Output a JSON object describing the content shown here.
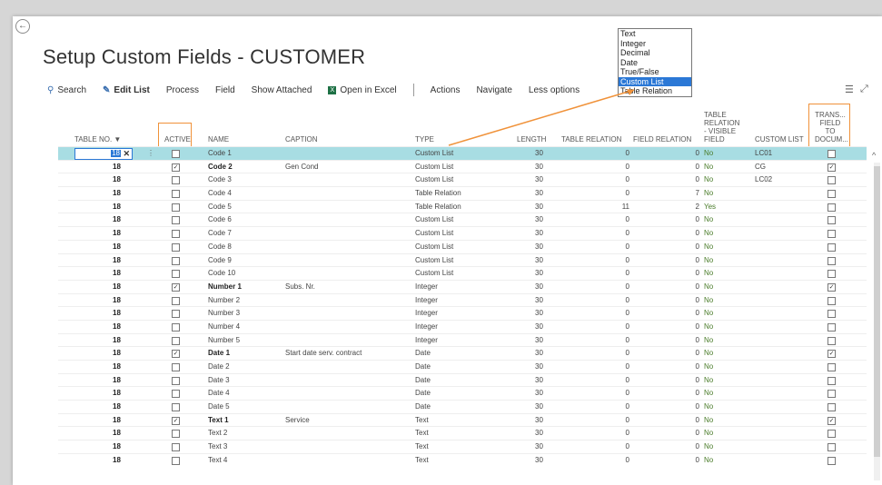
{
  "page": {
    "title": "Setup Custom Fields  - CUSTOMER"
  },
  "actions": {
    "search": "Search",
    "edit_list": "Edit List",
    "process": "Process",
    "field": "Field",
    "show_attached": "Show Attached",
    "open_excel": "Open in Excel",
    "actions": "Actions",
    "navigate": "Navigate",
    "less_options": "Less options"
  },
  "icons": {
    "back": "back-arrow-icon",
    "search": "search-icon",
    "edit_list": "edit-list-icon",
    "excel": "excel-icon",
    "filter": "filter-icon",
    "collapse": "collapse-icon"
  },
  "type_dropdown": {
    "options": [
      "Text",
      "Integer",
      "Decimal",
      "Date",
      "True/False",
      "Custom List",
      "Table Relation"
    ],
    "selected": "Custom List"
  },
  "columns": {
    "table_no": "TABLE NO. ▼",
    "active": "ACTIVE",
    "name": "NAME",
    "caption": "CAPTION",
    "type": "TYPE",
    "length": "LENGTH",
    "table_relation": "TABLE RELATION",
    "field_relation": "FIELD RELATION",
    "table_relation_visible_1": "TABLE",
    "table_relation_visible_2": "RELATION",
    "table_relation_visible_3": "- VISIBLE",
    "table_relation_visible_4": "FIELD",
    "custom_list": "CUSTOM LIST",
    "trans_1": "TRANS...",
    "trans_2": "FIELD",
    "trans_3": "TO",
    "trans_4": "DOCUM..."
  },
  "edit_row_value": "18",
  "rows": [
    {
      "table_no": "18",
      "active": false,
      "name": "Code 1",
      "bold": false,
      "caption": "",
      "type": "Custom List",
      "length": "30",
      "table_relation": "0",
      "field_relation": "0",
      "visible": "No",
      "custom_list": "LC01",
      "trans": false
    },
    {
      "table_no": "18",
      "active": true,
      "name": "Code 2",
      "bold": true,
      "caption": "Gen Cond",
      "type": "Custom List",
      "length": "30",
      "table_relation": "0",
      "field_relation": "0",
      "visible": "No",
      "custom_list": "CG",
      "trans": true
    },
    {
      "table_no": "18",
      "active": false,
      "name": "Code 3",
      "bold": false,
      "caption": "",
      "type": "Custom List",
      "length": "30",
      "table_relation": "0",
      "field_relation": "0",
      "visible": "No",
      "custom_list": "LC02",
      "trans": false
    },
    {
      "table_no": "18",
      "active": false,
      "name": "Code 4",
      "bold": false,
      "caption": "",
      "type": "Table Relation",
      "length": "30",
      "table_relation": "0",
      "field_relation": "7",
      "visible": "No",
      "custom_list": "",
      "trans": false
    },
    {
      "table_no": "18",
      "active": false,
      "name": "Code 5",
      "bold": false,
      "caption": "",
      "type": "Table Relation",
      "length": "30",
      "table_relation": "11",
      "field_relation": "2",
      "visible": "Yes",
      "custom_list": "",
      "trans": false
    },
    {
      "table_no": "18",
      "active": false,
      "name": "Code 6",
      "bold": false,
      "caption": "",
      "type": "Custom List",
      "length": "30",
      "table_relation": "0",
      "field_relation": "0",
      "visible": "No",
      "custom_list": "",
      "trans": false
    },
    {
      "table_no": "18",
      "active": false,
      "name": "Code 7",
      "bold": false,
      "caption": "",
      "type": "Custom List",
      "length": "30",
      "table_relation": "0",
      "field_relation": "0",
      "visible": "No",
      "custom_list": "",
      "trans": false
    },
    {
      "table_no": "18",
      "active": false,
      "name": "Code 8",
      "bold": false,
      "caption": "",
      "type": "Custom List",
      "length": "30",
      "table_relation": "0",
      "field_relation": "0",
      "visible": "No",
      "custom_list": "",
      "trans": false
    },
    {
      "table_no": "18",
      "active": false,
      "name": "Code 9",
      "bold": false,
      "caption": "",
      "type": "Custom List",
      "length": "30",
      "table_relation": "0",
      "field_relation": "0",
      "visible": "No",
      "custom_list": "",
      "trans": false
    },
    {
      "table_no": "18",
      "active": false,
      "name": "Code 10",
      "bold": false,
      "caption": "",
      "type": "Custom List",
      "length": "30",
      "table_relation": "0",
      "field_relation": "0",
      "visible": "No",
      "custom_list": "",
      "trans": false
    },
    {
      "table_no": "18",
      "active": true,
      "name": "Number 1",
      "bold": true,
      "caption": "Subs. Nr.",
      "type": "Integer",
      "length": "30",
      "table_relation": "0",
      "field_relation": "0",
      "visible": "No",
      "custom_list": "",
      "trans": true
    },
    {
      "table_no": "18",
      "active": false,
      "name": "Number 2",
      "bold": false,
      "caption": "",
      "type": "Integer",
      "length": "30",
      "table_relation": "0",
      "field_relation": "0",
      "visible": "No",
      "custom_list": "",
      "trans": false
    },
    {
      "table_no": "18",
      "active": false,
      "name": "Number 3",
      "bold": false,
      "caption": "",
      "type": "Integer",
      "length": "30",
      "table_relation": "0",
      "field_relation": "0",
      "visible": "No",
      "custom_list": "",
      "trans": false
    },
    {
      "table_no": "18",
      "active": false,
      "name": "Number 4",
      "bold": false,
      "caption": "",
      "type": "Integer",
      "length": "30",
      "table_relation": "0",
      "field_relation": "0",
      "visible": "No",
      "custom_list": "",
      "trans": false
    },
    {
      "table_no": "18",
      "active": false,
      "name": "Number 5",
      "bold": false,
      "caption": "",
      "type": "Integer",
      "length": "30",
      "table_relation": "0",
      "field_relation": "0",
      "visible": "No",
      "custom_list": "",
      "trans": false
    },
    {
      "table_no": "18",
      "active": true,
      "name": "Date 1",
      "bold": true,
      "caption": "Start date serv. contract",
      "type": "Date",
      "length": "30",
      "table_relation": "0",
      "field_relation": "0",
      "visible": "No",
      "custom_list": "",
      "trans": true
    },
    {
      "table_no": "18",
      "active": false,
      "name": "Date 2",
      "bold": false,
      "caption": "",
      "type": "Date",
      "length": "30",
      "table_relation": "0",
      "field_relation": "0",
      "visible": "No",
      "custom_list": "",
      "trans": false
    },
    {
      "table_no": "18",
      "active": false,
      "name": "Date 3",
      "bold": false,
      "caption": "",
      "type": "Date",
      "length": "30",
      "table_relation": "0",
      "field_relation": "0",
      "visible": "No",
      "custom_list": "",
      "trans": false
    },
    {
      "table_no": "18",
      "active": false,
      "name": "Date 4",
      "bold": false,
      "caption": "",
      "type": "Date",
      "length": "30",
      "table_relation": "0",
      "field_relation": "0",
      "visible": "No",
      "custom_list": "",
      "trans": false
    },
    {
      "table_no": "18",
      "active": false,
      "name": "Date 5",
      "bold": false,
      "caption": "",
      "type": "Date",
      "length": "30",
      "table_relation": "0",
      "field_relation": "0",
      "visible": "No",
      "custom_list": "",
      "trans": false
    },
    {
      "table_no": "18",
      "active": true,
      "name": "Text 1",
      "bold": true,
      "caption": "Service",
      "type": "Text",
      "length": "30",
      "table_relation": "0",
      "field_relation": "0",
      "visible": "No",
      "custom_list": "",
      "trans": true
    },
    {
      "table_no": "18",
      "active": false,
      "name": "Text 2",
      "bold": false,
      "caption": "",
      "type": "Text",
      "length": "30",
      "table_relation": "0",
      "field_relation": "0",
      "visible": "No",
      "custom_list": "",
      "trans": false
    },
    {
      "table_no": "18",
      "active": false,
      "name": "Text 3",
      "bold": false,
      "caption": "",
      "type": "Text",
      "length": "30",
      "table_relation": "0",
      "field_relation": "0",
      "visible": "No",
      "custom_list": "",
      "trans": false
    },
    {
      "table_no": "18",
      "active": false,
      "name": "Text 4",
      "bold": false,
      "caption": "",
      "type": "Text",
      "length": "30",
      "table_relation": "0",
      "field_relation": "0",
      "visible": "No",
      "custom_list": "",
      "trans": false
    }
  ],
  "colors": {
    "selected_row": "#a8dde3",
    "highlight_box": "#f0923a",
    "accent": "#2b78d6",
    "yes_no": "#4a7c2a"
  }
}
